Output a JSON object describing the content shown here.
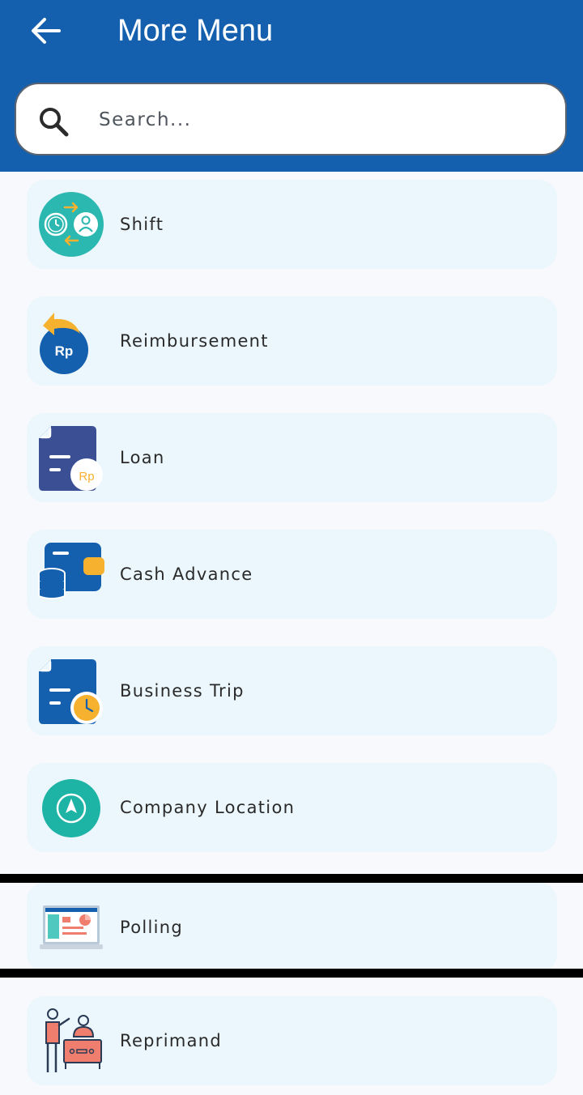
{
  "header": {
    "title": "More Menu",
    "back_icon": "arrow-left-icon",
    "bg_color": "#1460ae"
  },
  "search": {
    "placeholder": "Search...",
    "value": "",
    "icon": "search-icon"
  },
  "menu_items": [
    {
      "label": "Shift",
      "icon": "shift-swap-icon"
    },
    {
      "label": "Reimbursement",
      "icon": "reimbursement-icon"
    },
    {
      "label": "Loan",
      "icon": "loan-document-icon"
    },
    {
      "label": "Cash Advance",
      "icon": "wallet-coins-icon"
    },
    {
      "label": "Business Trip",
      "icon": "trip-document-clock-icon"
    },
    {
      "label": "Company Location",
      "icon": "location-compass-icon"
    },
    {
      "label": "Polling",
      "icon": "polling-screen-icon"
    },
    {
      "label": "Reprimand",
      "icon": "reprimand-meeting-icon"
    }
  ],
  "colors": {
    "primary": "#1460ae",
    "teal": "#2bb8b0",
    "navy": "#3a4f94",
    "accent": "#f6b12e",
    "card_bg": "#ebf7fc"
  }
}
